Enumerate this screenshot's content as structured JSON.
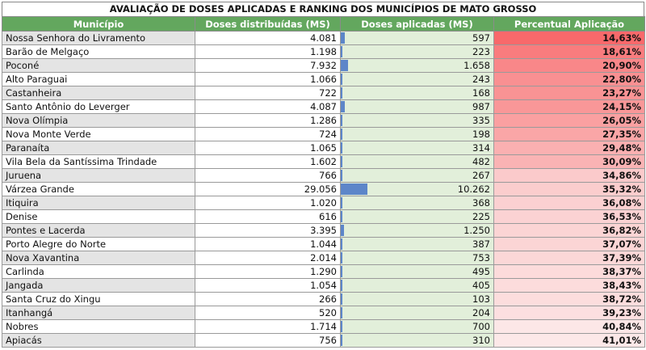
{
  "title": "AVALIAÇÃO DE DOSES APLICADAS E RANKING DOS MUNICÍPIOS DE MATO GROSSO",
  "headers": [
    "Município",
    "Doses distribuídas (MS)",
    "Doses aplicadas (MS)",
    "Percentual Aplicação"
  ],
  "colors": {
    "header_green": "#63a75e",
    "applied_bg": "#e2efda",
    "bar_blue": "#5d86c9",
    "pct_low": "#f8696b",
    "pct_high": "#fce8e8"
  },
  "rows": [
    {
      "municipio": "Nossa Senhora do Livramento",
      "distribuidas": "4.081",
      "aplicadas": "597",
      "percentual": "14,63%"
    },
    {
      "municipio": "Barão de Melgaço",
      "distribuidas": "1.198",
      "aplicadas": "223",
      "percentual": "18,61%"
    },
    {
      "municipio": "Poconé",
      "distribuidas": "7.932",
      "aplicadas": "1.658",
      "percentual": "20,90%"
    },
    {
      "municipio": "Alto Paraguai",
      "distribuidas": "1.066",
      "aplicadas": "243",
      "percentual": "22,80%"
    },
    {
      "municipio": "Castanheira",
      "distribuidas": "722",
      "aplicadas": "168",
      "percentual": "23,27%"
    },
    {
      "municipio": "Santo Antônio do Leverger",
      "distribuidas": "4.087",
      "aplicadas": "987",
      "percentual": "24,15%"
    },
    {
      "municipio": "Nova Olímpia",
      "distribuidas": "1.286",
      "aplicadas": "335",
      "percentual": "26,05%"
    },
    {
      "municipio": "Nova Monte Verde",
      "distribuidas": "724",
      "aplicadas": "198",
      "percentual": "27,35%"
    },
    {
      "municipio": "Paranaíta",
      "distribuidas": "1.065",
      "aplicadas": "314",
      "percentual": "29,48%"
    },
    {
      "municipio": "Vila Bela da Santíssima Trindade",
      "distribuidas": "1.602",
      "aplicadas": "482",
      "percentual": "30,09%"
    },
    {
      "municipio": "Juruena",
      "distribuidas": "766",
      "aplicadas": "267",
      "percentual": "34,86%"
    },
    {
      "municipio": "Várzea Grande",
      "distribuidas": "29.056",
      "aplicadas": "10.262",
      "percentual": "35,32%"
    },
    {
      "municipio": "Itiquira",
      "distribuidas": "1.020",
      "aplicadas": "368",
      "percentual": "36,08%"
    },
    {
      "municipio": "Denise",
      "distribuidas": "616",
      "aplicadas": "225",
      "percentual": "36,53%"
    },
    {
      "municipio": "Pontes e Lacerda",
      "distribuidas": "3.395",
      "aplicadas": "1.250",
      "percentual": "36,82%"
    },
    {
      "municipio": "Porto Alegre do Norte",
      "distribuidas": "1.044",
      "aplicadas": "387",
      "percentual": "37,07%"
    },
    {
      "municipio": "Nova Xavantina",
      "distribuidas": "2.014",
      "aplicadas": "753",
      "percentual": "37,39%"
    },
    {
      "municipio": "Carlinda",
      "distribuidas": "1.290",
      "aplicadas": "495",
      "percentual": "38,37%"
    },
    {
      "municipio": "Jangada",
      "distribuidas": "1.054",
      "aplicadas": "405",
      "percentual": "38,43%"
    },
    {
      "municipio": "Santa Cruz do Xingu",
      "distribuidas": "266",
      "aplicadas": "103",
      "percentual": "38,72%"
    },
    {
      "municipio": "Itanhangá",
      "distribuidas": "520",
      "aplicadas": "204",
      "percentual": "39,23%"
    },
    {
      "municipio": "Nobres",
      "distribuidas": "1.714",
      "aplicadas": "700",
      "percentual": "40,84%"
    },
    {
      "municipio": "Apiacás",
      "distribuidas": "756",
      "aplicadas": "310",
      "percentual": "41,01%"
    }
  ]
}
